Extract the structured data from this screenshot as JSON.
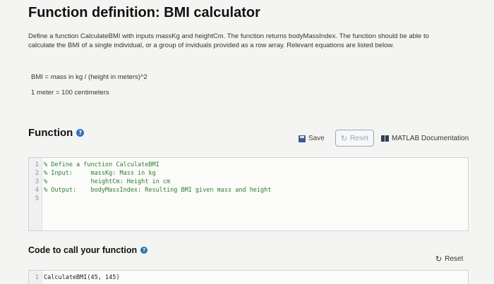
{
  "title": "Function definition: BMI calculator",
  "description": "Define a function CalculateBMI with inputs massKg and heightCm. The function returns bodyMassIndex. The function should be able to calculate the BMI of a single individual, or a group of inviduals provided as a row array. Relevant equations are listed below.",
  "equations": [
    "BMI = mass in kg / (height in meters)^2",
    "1 meter = 100 centimeters"
  ],
  "function_section": {
    "title": "Function",
    "help_icon": "?",
    "toolbar": {
      "save_label": "Save",
      "reset_label": "Reset",
      "doc_label": "MATLAB Documentation"
    },
    "code_lines": [
      {
        "num": "1",
        "text": "% Define a function CalculateBMI"
      },
      {
        "num": "2",
        "text": "% Input:     massKg: Mass in kg"
      },
      {
        "num": "3",
        "text": "%            heightCm: Height in cm"
      },
      {
        "num": "4",
        "text": "% Output:    bodyMassIndex: Resulting BMI given mass and height"
      },
      {
        "num": "5",
        "text": ""
      }
    ]
  },
  "call_section": {
    "title": "Code to call your function",
    "help_icon": "?",
    "reset_label": "Reset",
    "code_lines": [
      {
        "num": "1",
        "text": "CalculateBMI(45, 145)"
      }
    ]
  },
  "colors": {
    "accent": "#2b73b6",
    "comment": "#2e7d32"
  }
}
